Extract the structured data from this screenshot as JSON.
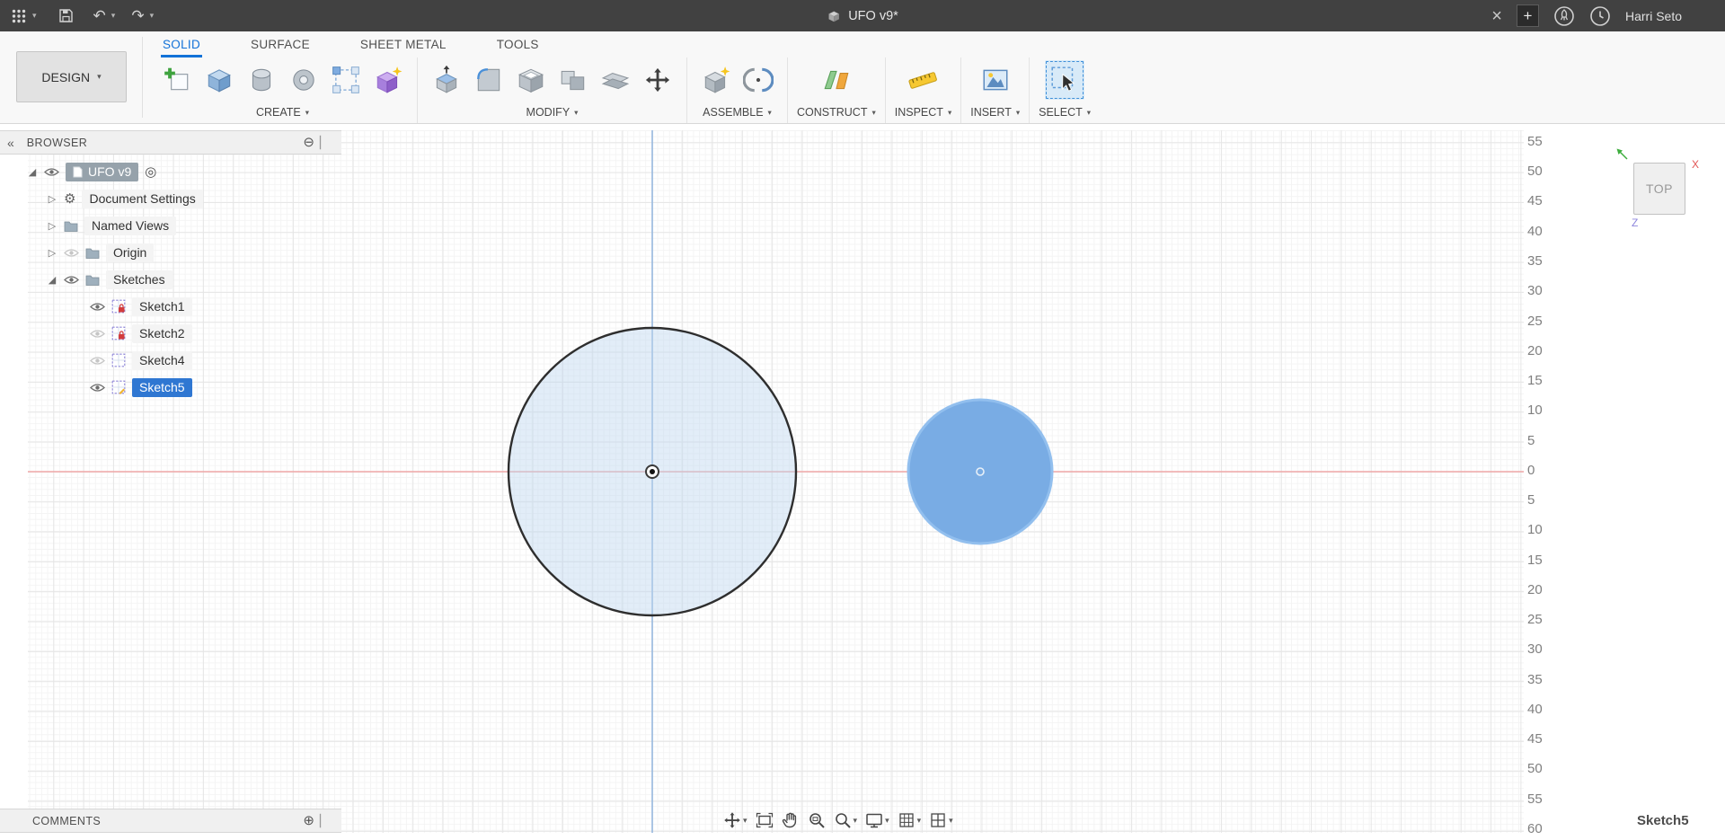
{
  "titlebar": {
    "title": "UFO v9*",
    "user": "Harri Seto"
  },
  "icons": {
    "caret_down": "▾",
    "collapse_left": "«",
    "minus_circle": "⊖",
    "plus_circle": "⊕",
    "close": "×",
    "plus": "+",
    "gear": "⚙",
    "radio": "◎",
    "expander_collapsed": "▷",
    "expander_expanded": "◢",
    "undo": "↶",
    "redo": "↷",
    "handle": "▏"
  },
  "toolbar": {
    "design": "DESIGN",
    "tabs": [
      {
        "label": "SOLID"
      },
      {
        "label": "SURFACE"
      },
      {
        "label": "SHEET METAL"
      },
      {
        "label": "TOOLS"
      }
    ],
    "groups": [
      {
        "label": "CREATE"
      },
      {
        "label": "MODIFY"
      },
      {
        "label": "ASSEMBLE"
      },
      {
        "label": "CONSTRUCT"
      },
      {
        "label": "INSPECT"
      },
      {
        "label": "INSERT"
      },
      {
        "label": "SELECT"
      }
    ]
  },
  "browser": {
    "header": "BROWSER",
    "rows": [
      {
        "label": "UFO v9"
      },
      {
        "label": "Document Settings"
      },
      {
        "label": "Named Views"
      },
      {
        "label": "Origin"
      },
      {
        "label": "Sketches"
      },
      {
        "label": "Sketch1"
      },
      {
        "label": "Sketch2"
      },
      {
        "label": "Sketch4"
      },
      {
        "label": "Sketch5"
      }
    ]
  },
  "canvas": {
    "viewcube": "TOP",
    "axes": {
      "x": "X",
      "z": "Z"
    },
    "active_sketch": "Sketch5",
    "ruler": [
      "55",
      "50",
      "45",
      "40",
      "35",
      "30",
      "25",
      "20",
      "15",
      "10",
      "5",
      "0",
      "5",
      "10",
      "15",
      "20",
      "25",
      "30",
      "35",
      "40",
      "45",
      "50",
      "55",
      "60"
    ]
  },
  "comments": {
    "header": "COMMENTS"
  },
  "colors": {
    "accent_blue": "#1272d8",
    "selection_blue": "#2f77d2",
    "axis_red": "#f09a9a",
    "axis_blue": "#7da9dc",
    "profile_fill_light": "#d7e7f6",
    "selected_profile": "#79ace4",
    "titlebar_bg": "#414141"
  }
}
